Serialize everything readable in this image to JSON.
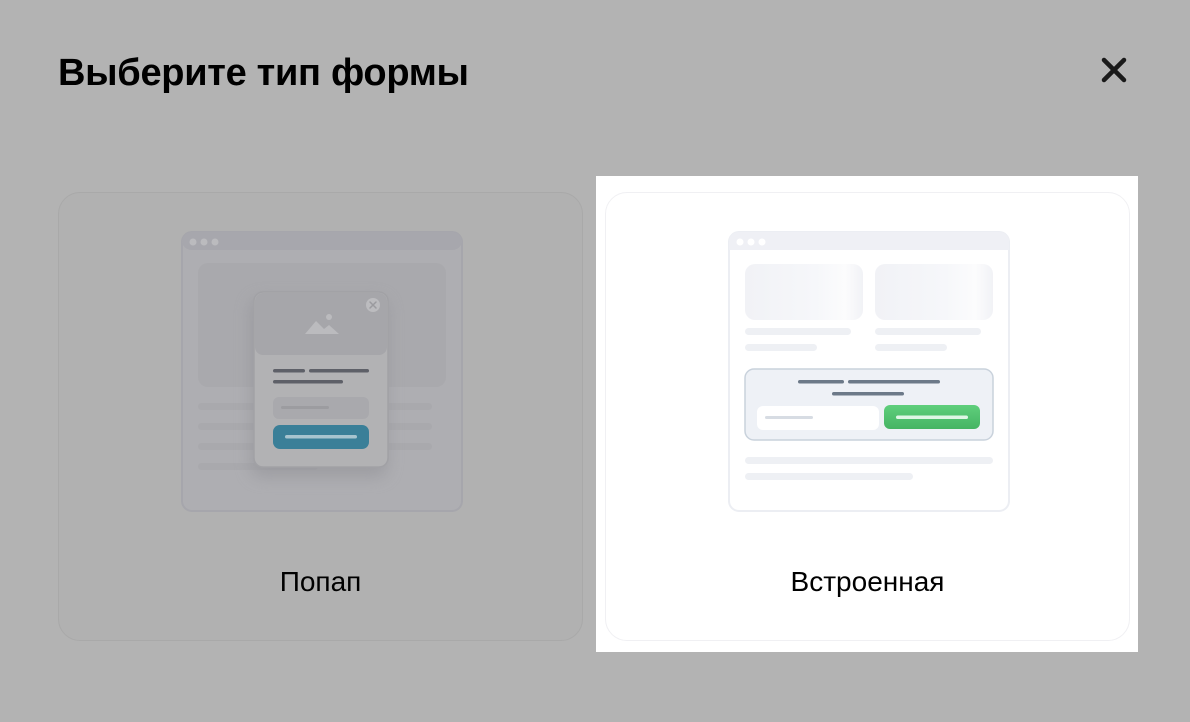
{
  "dialog": {
    "title": "Выберите тип формы",
    "close_icon": "close-icon"
  },
  "options": [
    {
      "label": "Попап",
      "icon": "popup-form-illustration",
      "selected": false
    },
    {
      "label": "Встроенная",
      "icon": "embedded-form-illustration",
      "selected": true
    }
  ],
  "colors": {
    "overlay": "#b3b3b3",
    "selected_card": "#ffffff",
    "popup_button": "#3a7f98",
    "embed_button": "#4cbc6a"
  }
}
